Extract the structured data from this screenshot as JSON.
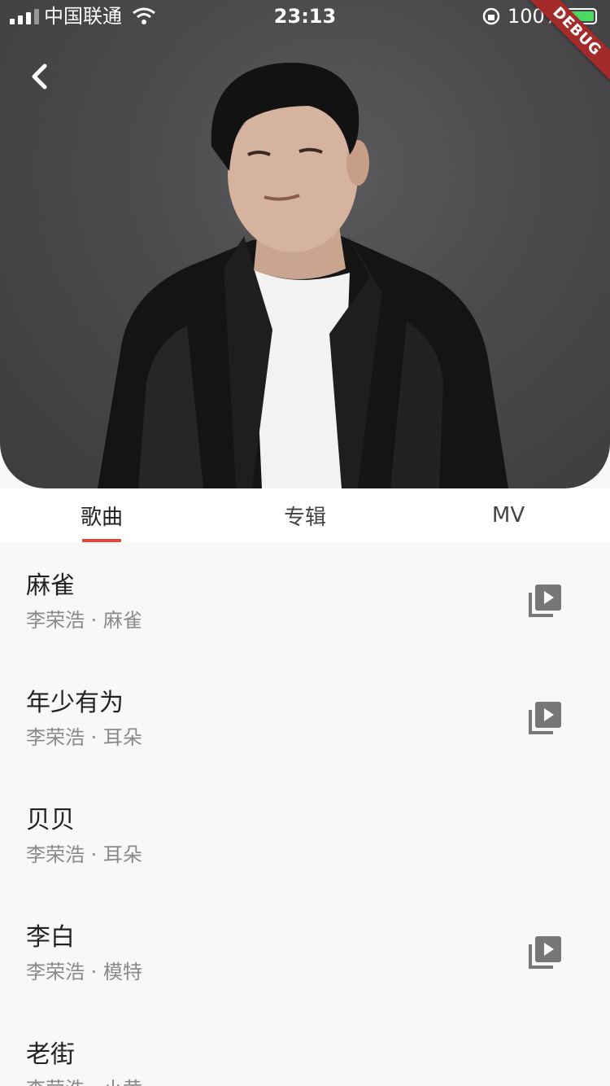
{
  "status_bar": {
    "carrier": "中国联通",
    "time": "23:13",
    "battery": "100%",
    "debug_label": "DEBUG"
  },
  "header": {
    "back_icon": "chevron-left-icon"
  },
  "tabs": [
    {
      "label": "歌曲",
      "active": true
    },
    {
      "label": "专辑",
      "active": false
    },
    {
      "label": "MV",
      "active": false
    }
  ],
  "songs": [
    {
      "title": "麻雀",
      "subtitle": "李荣浩 · 麻雀",
      "has_mv": true
    },
    {
      "title": "年少有为",
      "subtitle": "李荣浩 · 耳朵",
      "has_mv": true
    },
    {
      "title": "贝贝",
      "subtitle": "李荣浩 · 耳朵",
      "has_mv": false
    },
    {
      "title": "李白",
      "subtitle": "李荣浩 · 模特",
      "has_mv": true
    },
    {
      "title": "老街",
      "subtitle": "李荣浩 · 小黄",
      "has_mv": false
    }
  ],
  "colors": {
    "accent": "#d9483b",
    "battery": "#4cd964",
    "hero_bg": "#4a4a4c"
  }
}
